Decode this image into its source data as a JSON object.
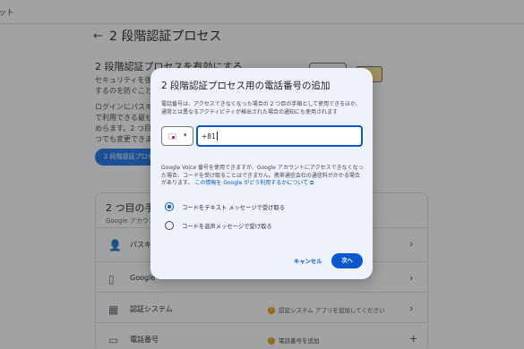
{
  "background": {
    "top_strip_text": "ット",
    "back_icon": "arrow-left-icon",
    "page_title": "2 段階認証プロセス",
    "section_heading": "2 段階認証プロセスを有効にする",
    "intro_lines": [
      "セキュリティを強化",
      "するのを防ぐことが"
    ],
    "passkey_lines": [
      "ログインにパスキー",
      "で利用できる最も安",
      "めらます。2 つ目",
      "つでも変更できます"
    ],
    "enable_button_label": "2 段階認証プロセス",
    "methods_title": "2 つ目の手順",
    "methods_subtitle": "Google アカウント",
    "methods": [
      {
        "icon": "passkey-icon",
        "label": "パスキー",
        "status": "",
        "action": "chevron-right-icon"
      },
      {
        "icon": "phone-icon",
        "label": "Google",
        "status": "",
        "action": "chevron-right-icon"
      },
      {
        "icon": "qr-code-icon",
        "label": "認証システム",
        "status": "認証システム アプリを追加してください",
        "action": "chevron-right-icon"
      },
      {
        "icon": "message-icon",
        "label": "電話番号",
        "status": "電話番号を追加",
        "action": "plus-icon"
      }
    ]
  },
  "dialog": {
    "title": "2 段階認証プロセス用の電話番号の追加",
    "description": "電話番号は、アクセスできなくなった場合の 2 つ目の手順として使用できるほか、通常とは異なるアクティビティが検出された場合の通知にも使用されます",
    "country_flag": "japan-flag-icon",
    "phone_value": "+81",
    "gv_note": "Google Voice 番号を使用できますが、Google アカウントにアクセスできなくなった場合、コードを受け取ることはできません。携帯通信会社の通信料がかかる場合があります。",
    "gv_link": "この情報を Google がどう利用するかについて",
    "radio_options": [
      {
        "label": "コードをテキスト メッセージで受け取る",
        "checked": true
      },
      {
        "label": "コードを音声メッセージで受け取る",
        "checked": false
      }
    ],
    "cancel_label": "キャンセル",
    "next_label": "次へ"
  }
}
